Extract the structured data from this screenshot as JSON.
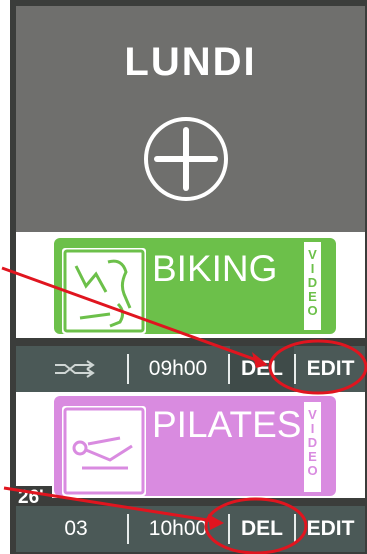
{
  "day": {
    "title": "LUNDI"
  },
  "sessions": [
    {
      "title": "BIKING",
      "video_label": "V\nI\nD\nE\nO",
      "color": "#6cc04a",
      "bar": {
        "left": "",
        "time": "09h00",
        "del": "DEL",
        "edit": "EDIT"
      }
    },
    {
      "title": "PILATES",
      "video_label": "V\nI\nD\nE\nO",
      "color": "#d98be0",
      "duration_badge": "26'",
      "bar": {
        "left": "03",
        "time": "10h00",
        "del": "DEL",
        "edit": "EDIT"
      }
    }
  ],
  "colors": {
    "annotation": "#e0151f",
    "bar": "#4b5957",
    "header": "#6f6f6d"
  },
  "icons": [
    "add-circle-icon",
    "bike-icon",
    "shuffle-icon",
    "pilates-icon"
  ]
}
